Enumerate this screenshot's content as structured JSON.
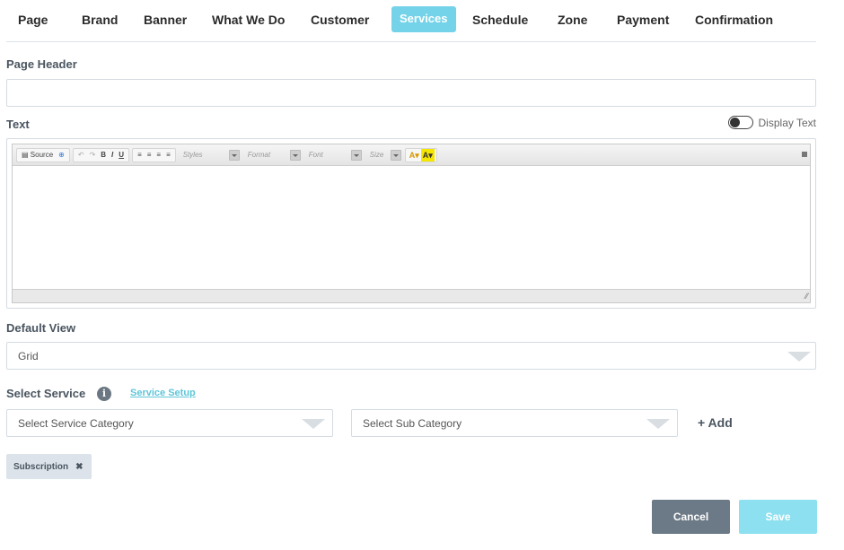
{
  "tabs": [
    {
      "label": "Page",
      "active": false
    },
    {
      "label": "Brand",
      "active": false
    },
    {
      "label": "Banner",
      "active": false
    },
    {
      "label": "What We Do",
      "active": false
    },
    {
      "label": "Customer",
      "active": false
    },
    {
      "label": "Services",
      "active": true
    },
    {
      "label": "Schedule",
      "active": false
    },
    {
      "label": "Zone",
      "active": false
    },
    {
      "label": "Payment",
      "active": false
    },
    {
      "label": "Confirmation",
      "active": false
    }
  ],
  "page_header": {
    "label": "Page Header",
    "value": ""
  },
  "text_section": {
    "label": "Text",
    "display_toggle_label": "Display Text",
    "display_toggle_on": false
  },
  "editor": {
    "source_label": "Source",
    "bold": "B",
    "italic": "I",
    "underline": "U",
    "styles_combo": "Styles",
    "format_combo": "Format",
    "font_combo": "Font",
    "size_combo": "Size",
    "text_color": "A",
    "bg_color": "A",
    "content": ""
  },
  "default_view": {
    "label": "Default View",
    "value": "Grid"
  },
  "select_service": {
    "label": "Select Service",
    "setup_link": "Service Setup",
    "category_placeholder": "Select Service Category",
    "sub_category_placeholder": "Select Sub Category",
    "add_label": "+ Add",
    "selected": [
      {
        "label": "Subscription",
        "remove": "✖"
      }
    ]
  },
  "actions": {
    "cancel": "Cancel",
    "save": "Save"
  },
  "colors": {
    "accent": "#74d3e8",
    "cancel": "#6c7986",
    "save": "#8de0ef",
    "chip": "#dce3ea"
  }
}
